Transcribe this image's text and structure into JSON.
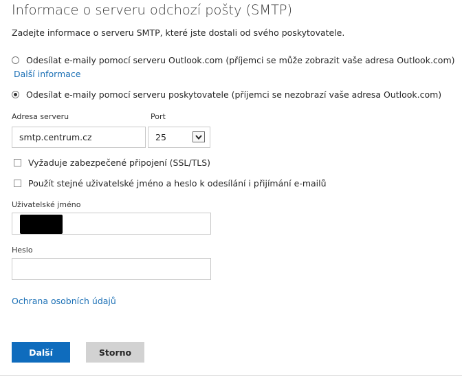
{
  "page": {
    "title": "Informace o serveru odchozí pošty (SMTP)",
    "intro": "Zadejte informace o serveru SMTP, které jste dostali od svého poskytovatele."
  },
  "options": {
    "outlook_label": "Odesílat e-maily pomocí serveru Outlook.com (příjemci se může zobrazit vaše adresa Outlook.com)",
    "outlook_selected": false,
    "more_info_link": "Další informace",
    "provider_label": "Odesílat e-maily pomocí serveru poskytovatele (příjemci se nezobrazí vaše adresa Outlook.com)",
    "provider_selected": true
  },
  "server": {
    "address_label": "Adresa serveru",
    "address_value": "smtp.centrum.cz",
    "port_label": "Port",
    "port_value": "25"
  },
  "checkboxes": {
    "ssl_label": "Vyžaduje zabezpečené připojení (SSL/TLS)",
    "ssl_checked": false,
    "same_credentials_label": "Použít stejné uživatelské jméno a heslo k odesílání i přijímání e-mailů",
    "same_credentials_checked": false
  },
  "credentials": {
    "username_label": "Uživatelské jméno",
    "username_value": "",
    "password_label": "Heslo",
    "password_value": ""
  },
  "footer": {
    "privacy_link": "Ochrana osobních údajů",
    "next_button": "Další",
    "cancel_button": "Storno"
  },
  "colors": {
    "accent": "#0f6cbd",
    "link": "#1a6fb5",
    "secondary_button": "#d2d2d2"
  },
  "icons": {
    "select_arrow": "chevron-down-icon"
  }
}
